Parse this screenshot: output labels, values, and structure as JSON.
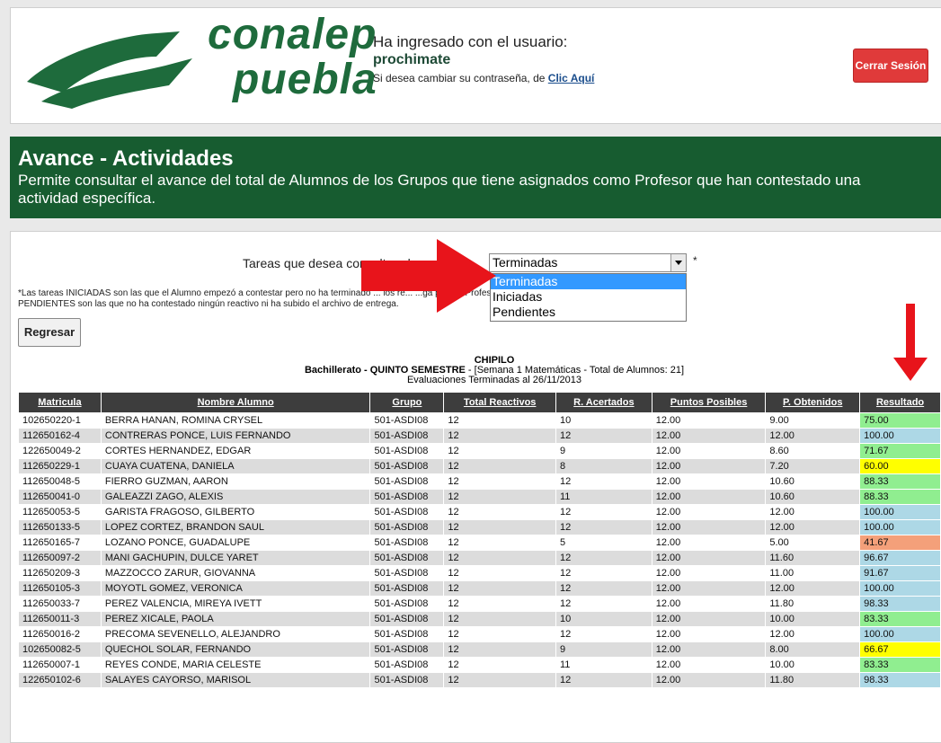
{
  "header": {
    "brand_line1": "conalep",
    "brand_line2": "puebla",
    "user_caption": "Ha ingresado con el usuario:",
    "username": "prochimate",
    "change_password_text": "Si desea cambiar su contraseña, de",
    "change_password_link": "Clic Aquí",
    "logout_label": "Cerrar Sesión"
  },
  "banner": {
    "title": "Avance - Actividades",
    "description_line1": "Permite consultar el avance del total de Alumnos de los Grupos que tiene asignados como Profesor que han contestado una",
    "description_line2": "actividad específica."
  },
  "filter": {
    "label": "Tareas que desea consultar el avance:",
    "selected": "Terminadas",
    "required_mark": "*",
    "options": [
      "Terminadas",
      "Iniciadas",
      "Pendientes"
    ]
  },
  "note": {
    "line1": "*Las tareas INICIADAS son las que el Alumno empezó a contestar pero no ha terminado ... los re... ...ga pero el Profesor no lo ha revisado, y las",
    "line2": "PENDIENTES son las que no ha contestado ningún reactivo ni ha subido el archivo de entrega."
  },
  "back_label": "Regresar",
  "caption": {
    "school": "CHIPILO",
    "program_bold": "Bachillerato - QUINTO SEMESTRE",
    "program_rest": " - [Semana 1 Matemáticas - Total de Alumnos: 21]",
    "date_line": "Evaluaciones Terminadas al 26/11/2013"
  },
  "table": {
    "headers": [
      "Matricula",
      "Nombre Alumno",
      "Grupo",
      "Total Reactivos",
      "R. Acertados",
      "Puntos Posibles",
      "P. Obtenidos",
      "Resultado"
    ],
    "rows": [
      {
        "matricula": "102650220-1",
        "nombre": "BERRA HANAN, ROMINA CRYSEL",
        "grupo": "501-ASDI08",
        "total": "12",
        "acertados": "10",
        "posibles": "12.00",
        "obtenidos": "9.00",
        "resultado": "75.00",
        "color": "#90ee90"
      },
      {
        "matricula": "112650162-4",
        "nombre": "CONTRERAS PONCE, LUIS FERNANDO",
        "grupo": "501-ASDI08",
        "total": "12",
        "acertados": "12",
        "posibles": "12.00",
        "obtenidos": "12.00",
        "resultado": "100.00",
        "color": "#add8e6"
      },
      {
        "matricula": "122650049-2",
        "nombre": "CORTES HERNANDEZ, EDGAR",
        "grupo": "501-ASDI08",
        "total": "12",
        "acertados": "9",
        "posibles": "12.00",
        "obtenidos": "8.60",
        "resultado": "71.67",
        "color": "#90ee90"
      },
      {
        "matricula": "112650229-1",
        "nombre": "CUAYA CUATENA, DANIELA",
        "grupo": "501-ASDI08",
        "total": "12",
        "acertados": "8",
        "posibles": "12.00",
        "obtenidos": "7.20",
        "resultado": "60.00",
        "color": "#ffff00"
      },
      {
        "matricula": "112650048-5",
        "nombre": "FIERRO GUZMAN, AARON",
        "grupo": "501-ASDI08",
        "total": "12",
        "acertados": "12",
        "posibles": "12.00",
        "obtenidos": "10.60",
        "resultado": "88.33",
        "color": "#90ee90"
      },
      {
        "matricula": "112650041-0",
        "nombre": "GALEAZZI ZAGO, ALEXIS",
        "grupo": "501-ASDI08",
        "total": "12",
        "acertados": "11",
        "posibles": "12.00",
        "obtenidos": "10.60",
        "resultado": "88.33",
        "color": "#90ee90"
      },
      {
        "matricula": "112650053-5",
        "nombre": "GARISTA FRAGOSO, GILBERTO",
        "grupo": "501-ASDI08",
        "total": "12",
        "acertados": "12",
        "posibles": "12.00",
        "obtenidos": "12.00",
        "resultado": "100.00",
        "color": "#add8e6"
      },
      {
        "matricula": "112650133-5",
        "nombre": "LOPEZ CORTEZ, BRANDON SAUL",
        "grupo": "501-ASDI08",
        "total": "12",
        "acertados": "12",
        "posibles": "12.00",
        "obtenidos": "12.00",
        "resultado": "100.00",
        "color": "#add8e6"
      },
      {
        "matricula": "112650165-7",
        "nombre": "LOZANO PONCE, GUADALUPE",
        "grupo": "501-ASDI08",
        "total": "12",
        "acertados": "5",
        "posibles": "12.00",
        "obtenidos": "5.00",
        "resultado": "41.67",
        "color": "#f4a07a"
      },
      {
        "matricula": "112650097-2",
        "nombre": "MANI GACHUPIN, DULCE YARET",
        "grupo": "501-ASDI08",
        "total": "12",
        "acertados": "12",
        "posibles": "12.00",
        "obtenidos": "11.60",
        "resultado": "96.67",
        "color": "#add8e6"
      },
      {
        "matricula": "112650209-3",
        "nombre": "MAZZOCCO ZARUR, GIOVANNA",
        "grupo": "501-ASDI08",
        "total": "12",
        "acertados": "12",
        "posibles": "12.00",
        "obtenidos": "11.00",
        "resultado": "91.67",
        "color": "#add8e6"
      },
      {
        "matricula": "112650105-3",
        "nombre": "MOYOTL GOMEZ, VERONICA",
        "grupo": "501-ASDI08",
        "total": "12",
        "acertados": "12",
        "posibles": "12.00",
        "obtenidos": "12.00",
        "resultado": "100.00",
        "color": "#add8e6"
      },
      {
        "matricula": "112650033-7",
        "nombre": "PEREZ VALENCIA, MIREYA IVETT",
        "grupo": "501-ASDI08",
        "total": "12",
        "acertados": "12",
        "posibles": "12.00",
        "obtenidos": "11.80",
        "resultado": "98.33",
        "color": "#add8e6"
      },
      {
        "matricula": "112650011-3",
        "nombre": "PEREZ XICALE, PAOLA",
        "grupo": "501-ASDI08",
        "total": "12",
        "acertados": "10",
        "posibles": "12.00",
        "obtenidos": "10.00",
        "resultado": "83.33",
        "color": "#90ee90"
      },
      {
        "matricula": "112650016-2",
        "nombre": "PRECOMA SEVENELLO, ALEJANDRO",
        "grupo": "501-ASDI08",
        "total": "12",
        "acertados": "12",
        "posibles": "12.00",
        "obtenidos": "12.00",
        "resultado": "100.00",
        "color": "#add8e6"
      },
      {
        "matricula": "102650082-5",
        "nombre": "QUECHOL SOLAR, FERNANDO",
        "grupo": "501-ASDI08",
        "total": "12",
        "acertados": "9",
        "posibles": "12.00",
        "obtenidos": "8.00",
        "resultado": "66.67",
        "color": "#ffff00"
      },
      {
        "matricula": "112650007-1",
        "nombre": "REYES CONDE, MARIA CELESTE",
        "grupo": "501-ASDI08",
        "total": "12",
        "acertados": "11",
        "posibles": "12.00",
        "obtenidos": "10.00",
        "resultado": "83.33",
        "color": "#90ee90"
      },
      {
        "matricula": "122650102-6",
        "nombre": "SALAYES CAYORSO, MARISOL",
        "grupo": "501-ASDI08",
        "total": "12",
        "acertados": "12",
        "posibles": "12.00",
        "obtenidos": "11.80",
        "resultado": "98.33",
        "color": "#add8e6"
      }
    ]
  },
  "colors": {
    "brand_green": "#1e6b3c",
    "banner_green": "#175c30",
    "logout_red": "#e03a3a",
    "header_dark": "#3d3d3d",
    "annotation_arrow": "#e8141b"
  },
  "icons": [
    "conalep-logo-icon",
    "dropdown-arrow-icon",
    "red-arrow-right-icon",
    "red-arrow-down-icon"
  ]
}
